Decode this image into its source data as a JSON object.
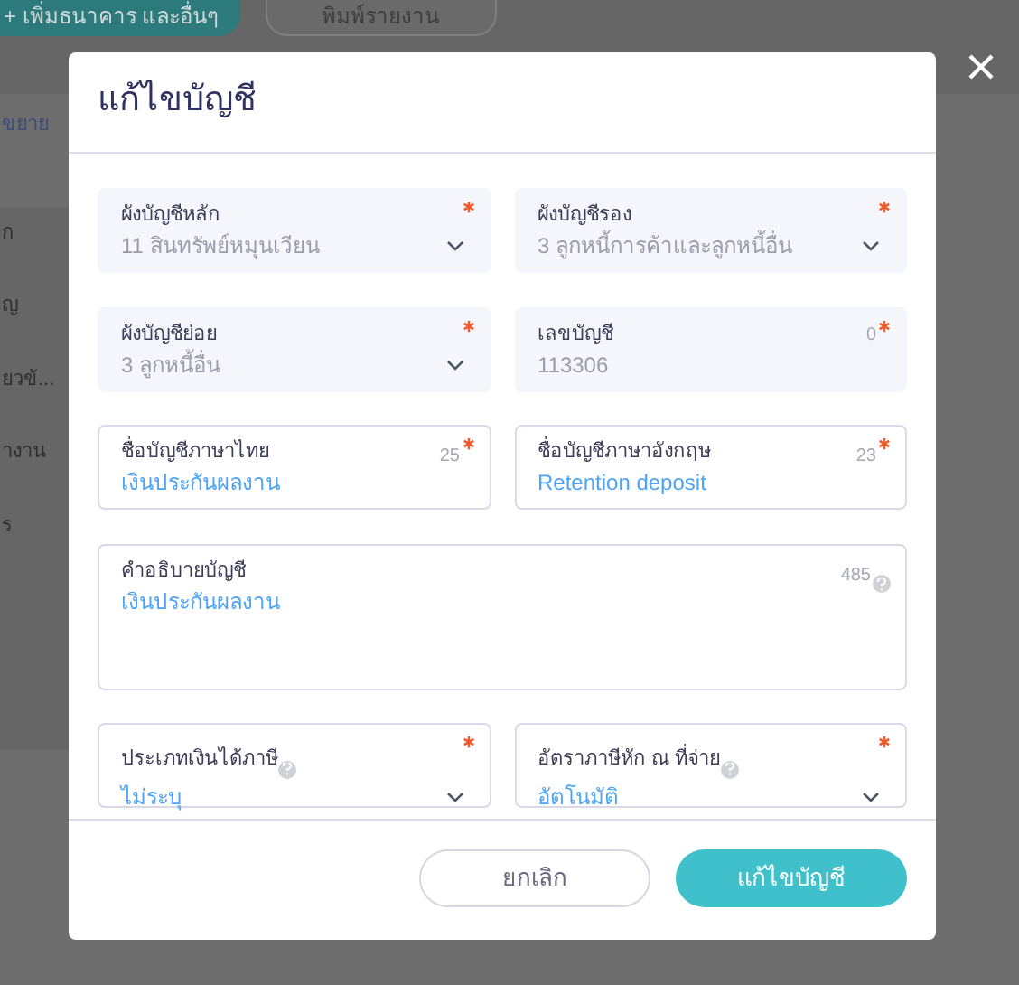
{
  "background": {
    "buttons": [
      {
        "label": "+ เพิ่มธนาคาร และอื่นๆ",
        "kind": "primary"
      },
      {
        "label": "พิมพ์รายงาน",
        "kind": "outline"
      }
    ],
    "link": "ขยาย",
    "sidebar_items": [
      "ก",
      "ญ",
      "ยวข้...",
      "างาน",
      "ร"
    ]
  },
  "modal": {
    "title": "แก้ไขบัญชี",
    "fields": [
      {
        "kind": "locked_select",
        "label": "ผังบัญชีหลัก",
        "value": "11 สินทรัพย์หมุนเวียน",
        "required": true,
        "help": false
      },
      {
        "kind": "locked_select",
        "label": "ผังบัญชีรอง",
        "value": "3 ลูกหนี้การค้าและลูกหนี้อื่น",
        "required": true,
        "help": false
      },
      {
        "kind": "locked_select",
        "label": "ผังบัญชีย่อย",
        "value": "3 ลูกหนี้อื่น",
        "required": true,
        "help": false
      },
      {
        "kind": "locked_text",
        "label": "เลขบัญชี",
        "value": "113306",
        "counter": "0",
        "required": true,
        "help": false
      },
      {
        "kind": "text",
        "label": "ชื่อบัญชีภาษาไทย",
        "value": "เงินประกันผลงาน",
        "counter": "25",
        "required": true,
        "help": false
      },
      {
        "kind": "text",
        "label": "ชื่อบัญชีภาษาอังกฤษ",
        "value": "Retention deposit",
        "counter": "23",
        "required": true,
        "help": false
      },
      {
        "kind": "textarea",
        "label": "คำอธิบายบัญชี",
        "value": "เงินประกันผลงาน",
        "counter": "485",
        "required": false,
        "help": true
      },
      {
        "kind": "select",
        "label": "ประเภทเงินได้ภาษี",
        "value": "ไม่ระบุ",
        "required": true,
        "help": true
      },
      {
        "kind": "select",
        "label": "อัตราภาษีหัก ณ ที่จ่าย",
        "value": "อัตโนมัติ",
        "required": true,
        "help": true
      }
    ],
    "buttons": [
      {
        "label": "ยกเลิก",
        "kind": "secondary"
      },
      {
        "label": "แก้ไขบัญชี",
        "kind": "primary"
      }
    ]
  }
}
